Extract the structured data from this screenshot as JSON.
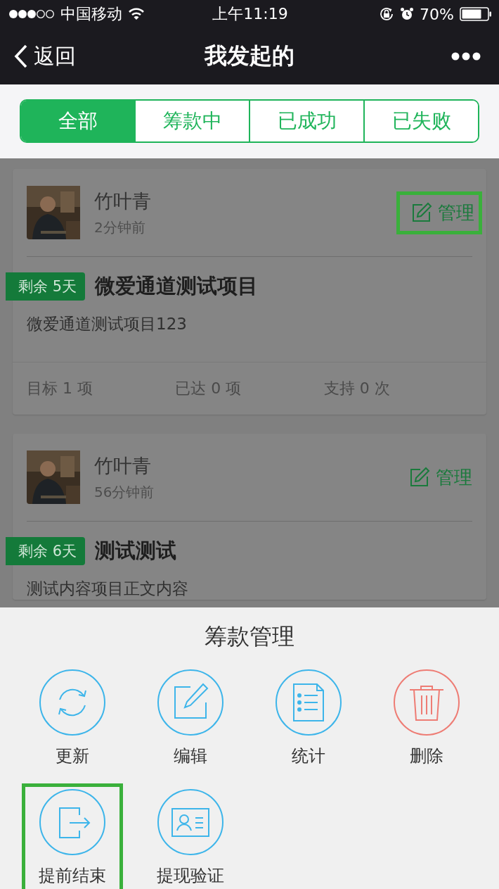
{
  "status_bar": {
    "carrier": "中国移动",
    "time": "上午11:19",
    "battery": "70%"
  },
  "nav": {
    "back": "返回",
    "title": "我发起的"
  },
  "tabs": [
    {
      "label": "全部",
      "selected": true
    },
    {
      "label": "筹款中",
      "selected": false
    },
    {
      "label": "已成功",
      "selected": false
    },
    {
      "label": "已失败",
      "selected": false
    }
  ],
  "projects": [
    {
      "name": "竹叶青",
      "time": "2分钟前",
      "manage": "管理",
      "highlighted": true,
      "tag": "剩余 5天",
      "title": "微爱通道测试项目",
      "body": "微爱通道测试项目123",
      "stats": [
        "目标 1 项",
        "已达 0 项",
        "支持 0 次"
      ]
    },
    {
      "name": "竹叶青",
      "time": "56分钟前",
      "manage": "管理",
      "highlighted": false,
      "tag": "剩余 6天",
      "title": "测试测试",
      "body": "测试内容项目正文内容"
    }
  ],
  "sheet": {
    "title": "筹款管理",
    "actions": [
      {
        "label": "更新",
        "color": "#3db5ea",
        "highlighted": false
      },
      {
        "label": "编辑",
        "color": "#3db5ea",
        "highlighted": false
      },
      {
        "label": "统计",
        "color": "#3db5ea",
        "highlighted": false
      },
      {
        "label": "删除",
        "color": "#ee7c74",
        "highlighted": false
      },
      {
        "label": "提前结束",
        "color": "#3db5ea",
        "highlighted": true
      },
      {
        "label": "提现验证",
        "color": "#3db5ea",
        "highlighted": false
      }
    ]
  }
}
